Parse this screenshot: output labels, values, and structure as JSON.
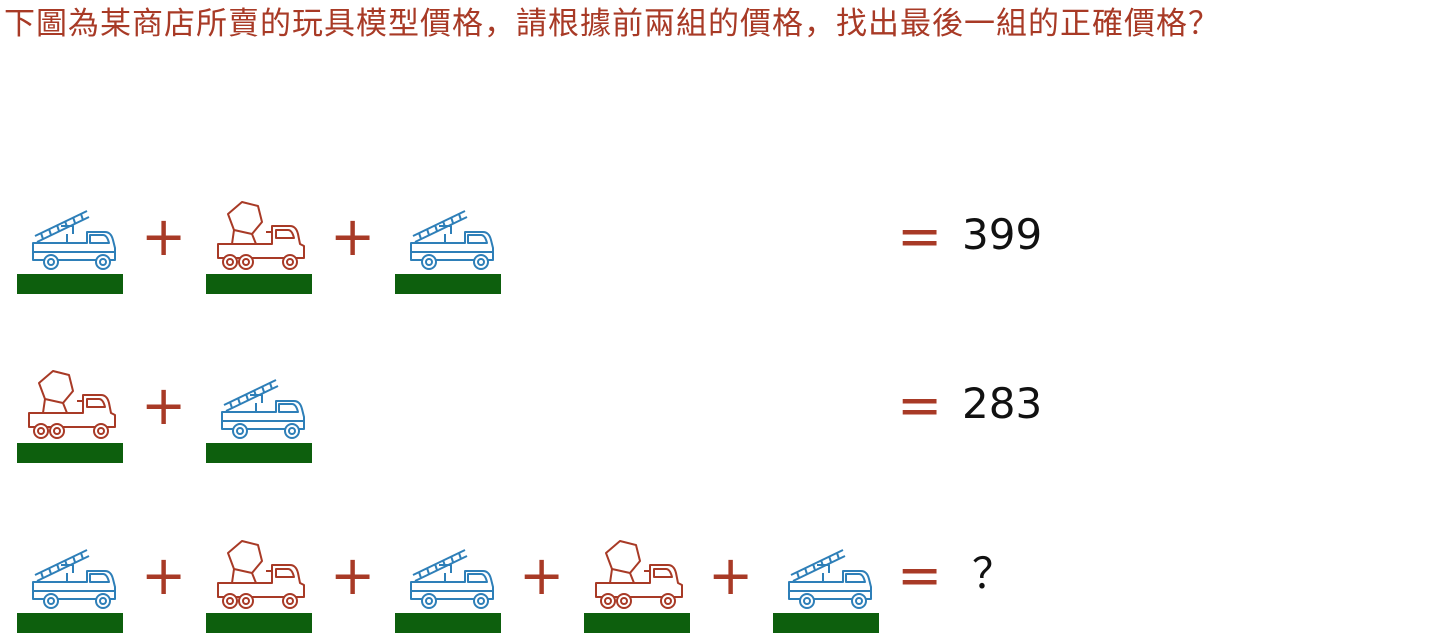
{
  "question": "下圖為某商店所賣的玩具模型價格，請根據前兩組的價格，找出最後一組的正確價格？",
  "colors": {
    "text": "#a83a26",
    "ladder_truck": "#2e7fb8",
    "mixer_truck": "#a83a26",
    "ground": "#0d5f0d",
    "answer": "#111111"
  },
  "symbols": {
    "plus": "+",
    "equals": "="
  },
  "rows": [
    {
      "items": [
        "ladder-truck",
        "mixer-truck",
        "ladder-truck"
      ],
      "result": "399"
    },
    {
      "items": [
        "mixer-truck",
        "ladder-truck"
      ],
      "result": "283"
    },
    {
      "items": [
        "ladder-truck",
        "mixer-truck",
        "ladder-truck",
        "mixer-truck",
        "ladder-truck"
      ],
      "result": "？"
    }
  ]
}
